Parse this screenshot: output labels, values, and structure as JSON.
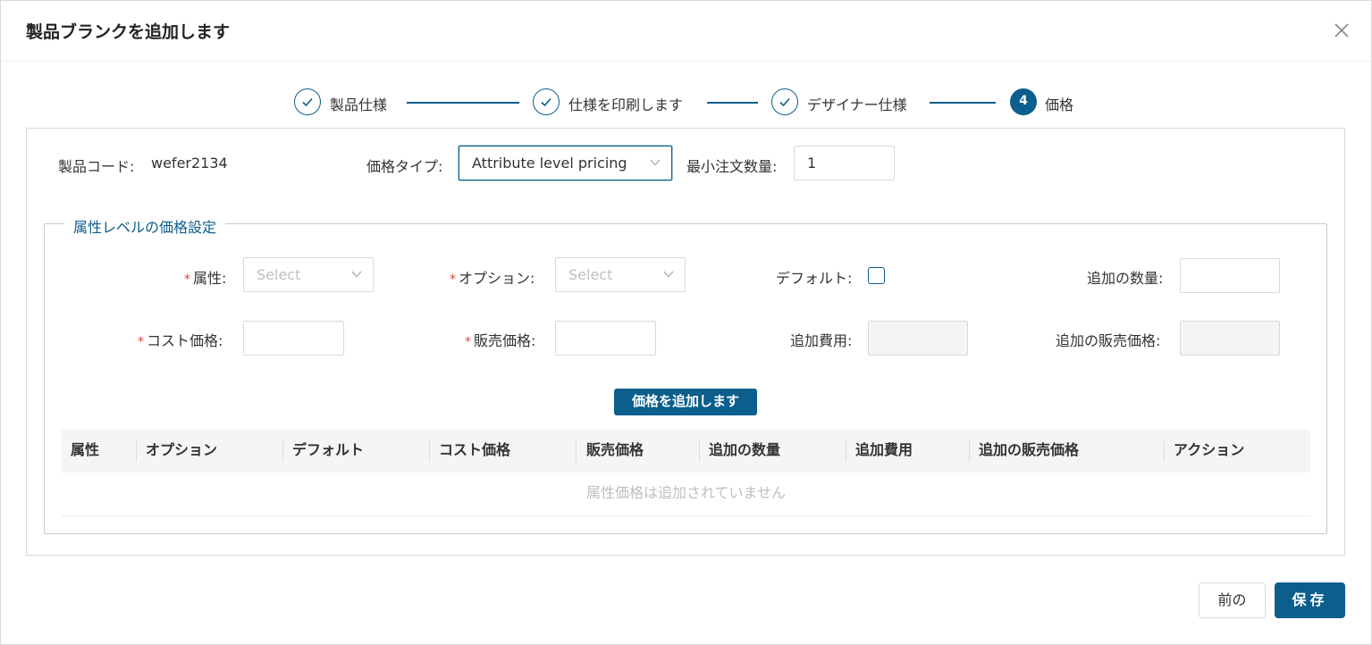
{
  "dialog": {
    "title": "製品ブランクを追加します",
    "accent_color": "#0c5e8c"
  },
  "steps": [
    {
      "label": "製品仕様",
      "status": "done"
    },
    {
      "label": "仕様を印刷します",
      "status": "done"
    },
    {
      "label": "デザイナー仕様",
      "status": "done"
    },
    {
      "label": "価格",
      "status": "active",
      "number": "4"
    }
  ],
  "header_fields": {
    "product_code_label": "製品コード:",
    "product_code_value": "wefer2134",
    "price_type_label": "価格タイプ:",
    "price_type_value": "Attribute level pricing",
    "moq_label": "最小注文数量:",
    "moq_value": "1"
  },
  "attribute_pricing": {
    "legend": "属性レベルの価格設定",
    "attribute_label": "属性:",
    "attribute_placeholder": "Select",
    "option_label": "オプション:",
    "option_placeholder": "Select",
    "default_label": "デフォルト:",
    "additional_qty_label": "追加の数量:",
    "cost_price_label": "コスト価格:",
    "sale_price_label": "販売価格:",
    "additional_fee_label": "追加費用:",
    "additional_sale_price_label": "追加の販売価格:",
    "required_mark": "*",
    "add_price_button": "価格を追加します"
  },
  "table": {
    "columns": [
      "属性",
      "オプション",
      "デフォルト",
      "コスト価格",
      "販売価格",
      "追加の数量",
      "追加費用",
      "追加の販売価格",
      "アクション"
    ],
    "empty_text": "属性価格は追加されていません"
  },
  "footer": {
    "prev_label": "前の",
    "save_label": "保存"
  }
}
